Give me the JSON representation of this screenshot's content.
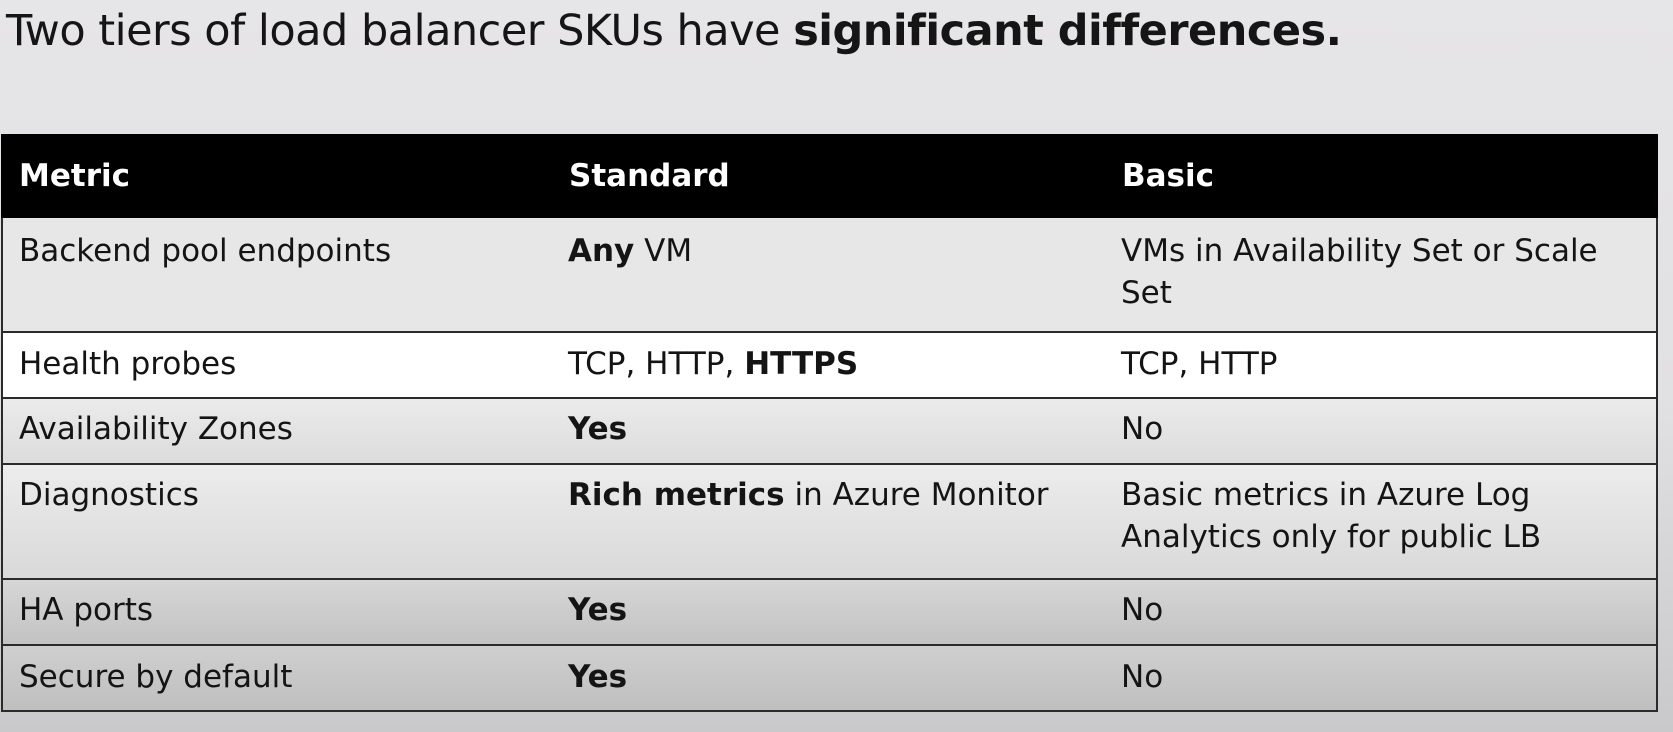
{
  "heading": {
    "prefix": "Two tiers of load balancer SKUs have ",
    "emphasis": "significant differences."
  },
  "table": {
    "headers": [
      "Metric",
      "Standard",
      "Basic"
    ],
    "rows": [
      {
        "metric": "Backend pool endpoints",
        "standard_bold": "Any",
        "standard_text": " VM",
        "basic_bold": "",
        "basic_text": "VMs in Availability Set or Scale Set"
      },
      {
        "metric": "Health probes",
        "standard_text": "TCP, HTTP, ",
        "standard_bold": "HTTPS",
        "basic_bold": "",
        "basic_text": "TCP, HTTP"
      },
      {
        "metric": "Availability Zones",
        "standard_bold": "Yes",
        "standard_text": "",
        "basic_bold": "",
        "basic_text": "No"
      },
      {
        "metric": "Diagnostics",
        "standard_bold": "Rich metrics",
        "standard_text": " in Azure Monitor",
        "basic_bold": "",
        "basic_text": "Basic metrics in Azure Log Analytics only for public LB"
      },
      {
        "metric": "HA ports",
        "standard_bold": "Yes",
        "standard_text": "",
        "basic_bold": "",
        "basic_text": "No"
      },
      {
        "metric": "Secure by default",
        "standard_bold": "Yes",
        "standard_text": "",
        "basic_bold": "",
        "basic_text": "No"
      }
    ]
  }
}
